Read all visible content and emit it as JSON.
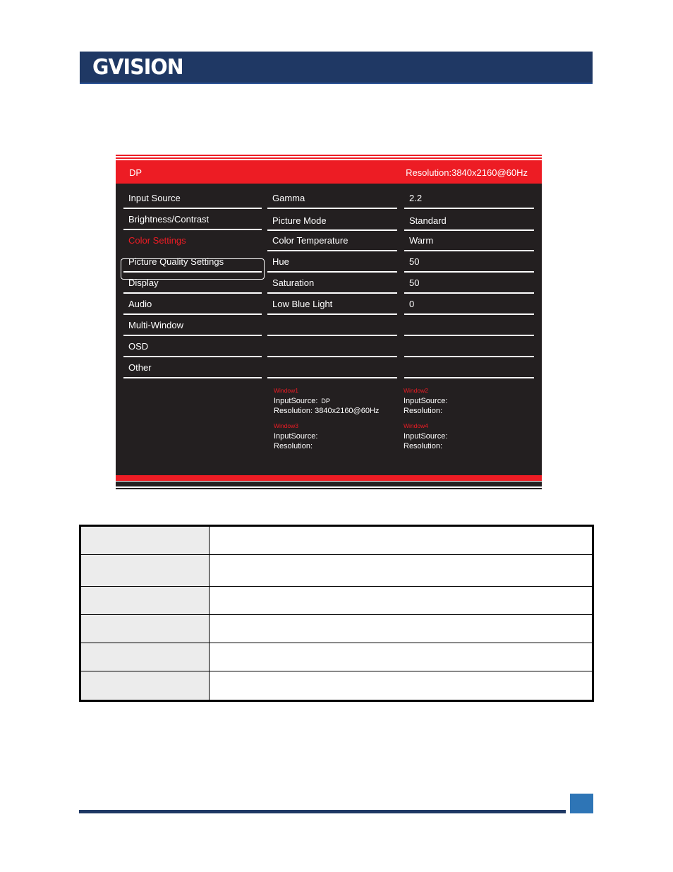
{
  "header": {
    "logo_text": "GVISION",
    "banner_color": "#1f3864"
  },
  "osd": {
    "accent_color": "#ed1c24",
    "background_color": "#231f20",
    "top_bar": {
      "input_source": "DP",
      "resolution": "Resolution:3840x2160@60Hz"
    },
    "menu": [
      {
        "label": "Input Source",
        "selected": false
      },
      {
        "label": "Brightness/Contrast",
        "selected": false
      },
      {
        "label": "Color Settings",
        "selected": true
      },
      {
        "label": "Picture Quality Settings",
        "selected": false
      },
      {
        "label": "Display",
        "selected": false
      },
      {
        "label": "Audio",
        "selected": false
      },
      {
        "label": "Multi-Window",
        "selected": false
      },
      {
        "label": "OSD",
        "selected": false
      },
      {
        "label": "Other",
        "selected": false
      }
    ],
    "settings": [
      {
        "name": "Gamma",
        "value": "2.2"
      },
      {
        "name": "Picture Mode",
        "value": "Standard"
      },
      {
        "name": "Color Temperature",
        "value": "Warm"
      },
      {
        "name": "Hue",
        "value": "50"
      },
      {
        "name": "Saturation",
        "value": "50"
      },
      {
        "name": "Low Blue Light",
        "value": "0"
      },
      {
        "name": "",
        "value": ""
      },
      {
        "name": "",
        "value": ""
      },
      {
        "name": "",
        "value": ""
      }
    ],
    "windows": [
      {
        "title": "Window1",
        "input_label": "InputSource:",
        "input_value": "DP",
        "resolution_label": "Resolution:",
        "resolution_value": "3840x2160@60Hz"
      },
      {
        "title": "Window2",
        "input_label": "InputSource:",
        "input_value": "",
        "resolution_label": "Resolution:",
        "resolution_value": ""
      },
      {
        "title": "Window3",
        "input_label": "InputSource:",
        "input_value": "",
        "resolution_label": "Resolution:",
        "resolution_value": ""
      },
      {
        "title": "Window4",
        "input_label": "InputSource:",
        "input_value": "",
        "resolution_label": "Resolution:",
        "resolution_value": ""
      }
    ]
  },
  "table": {
    "rows": [
      {
        "label": "",
        "description": ""
      },
      {
        "label": "",
        "description": ""
      },
      {
        "label": "",
        "description": ""
      },
      {
        "label": "",
        "description": ""
      },
      {
        "label": "",
        "description": ""
      },
      {
        "label": "",
        "description": ""
      }
    ]
  },
  "footer": {
    "page_number": "",
    "line_color": "#1f3864",
    "page_box_color": "#2e75b6"
  }
}
